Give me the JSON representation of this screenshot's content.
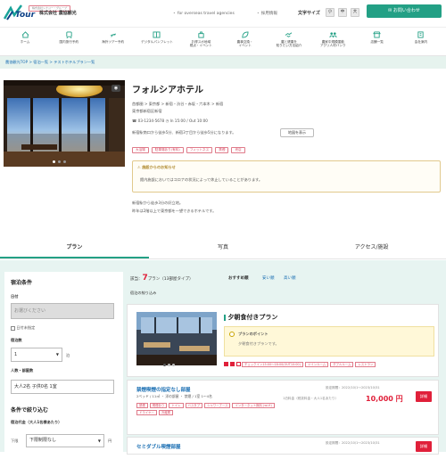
{
  "header": {
    "logo_word": "Tour",
    "tagline": "株式会社シナジー・グループ",
    "company": "株式会社 農協観光",
    "link_overseas": "・ for overseas travel agencies",
    "link_ir": "・ 採用情報",
    "font_size_label": "文字サイズ",
    "font_sizes": [
      "小",
      "中",
      "大"
    ],
    "contact_label": "お問い合わせ"
  },
  "nav": [
    {
      "label": "ホーム",
      "icon": "home-icon"
    },
    {
      "label": "国内旅行予約",
      "icon": "train-icon"
    },
    {
      "label": "海外ツアー予約",
      "icon": "plane-icon"
    },
    {
      "label": "デジタルパンフレット",
      "icon": "book-icon"
    },
    {
      "label": "お得スポ地域\n視点・イベント",
      "icon": "bag-icon"
    },
    {
      "label": "農事交換・\nイベント",
      "icon": "leaf-icon"
    },
    {
      "label": "農と健康を\n知りたい方法紹介",
      "icon": "handshake-icon"
    },
    {
      "label": "農家中規模運動\nアグリ人材バンク",
      "icon": "people-icon"
    },
    {
      "label": "店舗一覧",
      "icon": "shop-icon"
    },
    {
      "label": "会社案内",
      "icon": "building-icon"
    }
  ],
  "breadcrumb": "農協観光TOP > 宿泊一覧 > テストホテルプラン一覧",
  "hotel": {
    "name": "フォルシアホテル",
    "area": "首都圏 > 東京都 > 新宿・渋谷・赤坂・六本木 > 新宿",
    "address": "東京都新宿区新宿",
    "tel": "03-1234-5678",
    "checkin": "In 15:00 / Out 10:00",
    "access": "新宿駅南口から徒歩5分、新宿3丁目から徒歩5分になります。",
    "map_button": "地図を表示",
    "tags": [
      "大浴場",
      "駐車場あり(有料)",
      "フィットネス",
      "禁煙",
      "売店"
    ],
    "notice_title": "施設からのお知らせ",
    "notice_body": "館内施設においてはコロナの状況によって休止していることがあります。",
    "desc1": "新宿駅から徒歩3分の好立地。",
    "desc2": "昨年は2階以上で東京都を一望できるホテルです。"
  },
  "tabs": [
    "プラン",
    "写真",
    "アクセス/施設"
  ],
  "sidebar": {
    "title": "宿泊条件",
    "date_label": "日付",
    "date_placeholder": "お選びください",
    "undecided_label": "日付未指定",
    "nights_label": "宿泊数",
    "nights_value": "1",
    "nights_unit": "泊",
    "guests_label": "人数・部屋数",
    "guests_value": "大人2名 子供0名",
    "rooms_value": "1室",
    "narrow_title": "条件で絞り込む",
    "price_label": "宿泊代金（大人1名様あたり）",
    "price_min_label": "下限",
    "price_min_value": "下限制限なし",
    "price_unit": "円"
  },
  "main": {
    "count_label": "該当：",
    "count_value": "7",
    "count_suffix": "プラン（13部屋タイプ）",
    "sort_label": "おすすめ順",
    "sort_cheap": "安い順",
    "sort_expensive": "高い順",
    "filter_label": "宿泊の絞り込み",
    "plan_title": "夕朝食付きプラン",
    "plan_point_title": "プランのポイント",
    "plan_point_body": "夕朝食付きプランです。",
    "plan_tags": [
      "チェックイン15:00～18:00(OUT10:00)",
      "ツインルーム",
      "ダブルルーム",
      "レストラン"
    ],
    "room1_name": "禁煙喫煙の指定なし部屋",
    "room1_spec": "2ベッド / 11㎡ ・ 洋の部屋 ・ 禁煙 / 1室 1〜4名",
    "room1_tags": [
      "禁煙",
      "喫煙あり",
      "トイレ",
      "バスタブ",
      "シャワーブース",
      "インターネット無料 (wi-fi)",
      "ドライヤー",
      "冷蔵庫"
    ],
    "room1_period": "設定期間：2022/10/1～2023/10/31",
    "room1_price_label": "1泊料金（税抜料金・大人1名あたり）",
    "room1_price": "10,000 円",
    "room2_name": "セミダブル喫煙部屋",
    "room2_period": "設定期間：2022/10/1～2023/10/31",
    "detail_button": "詳細"
  }
}
